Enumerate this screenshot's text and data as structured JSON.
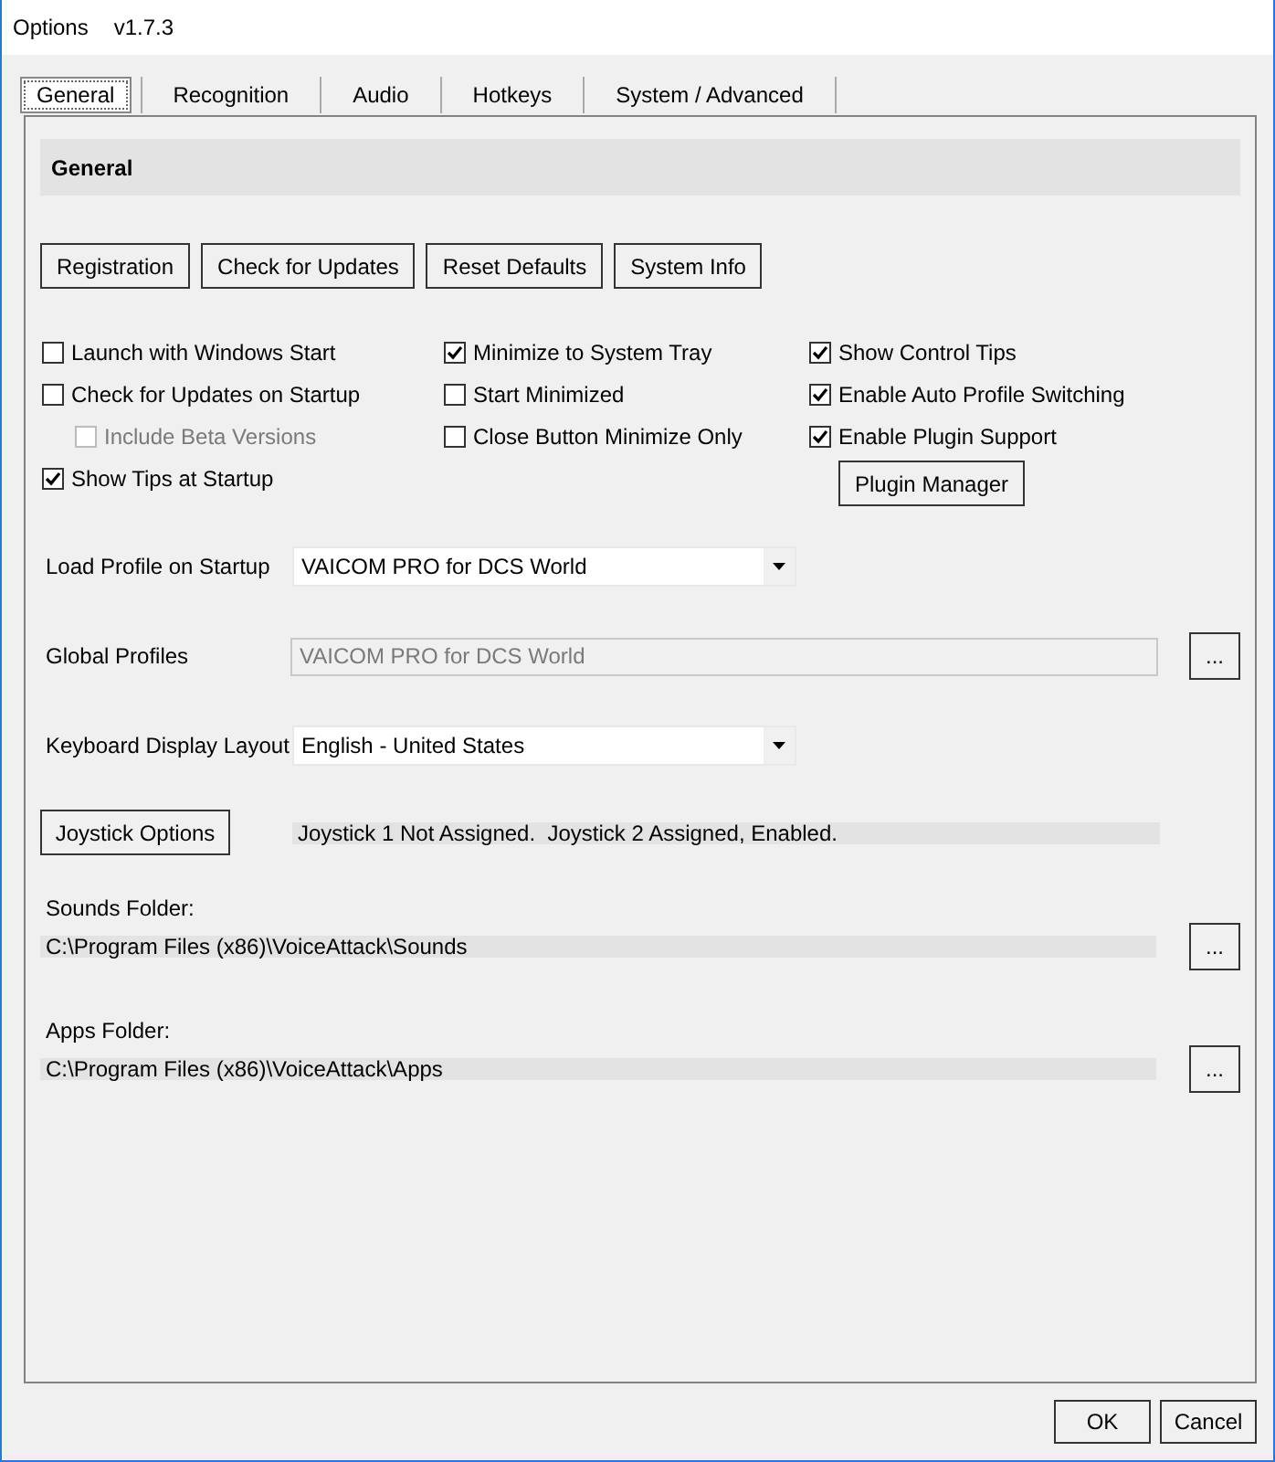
{
  "window": {
    "title": "Options",
    "version": "v1.7.3"
  },
  "tabs": [
    {
      "label": "General",
      "selected": true
    },
    {
      "label": "Recognition",
      "selected": false
    },
    {
      "label": "Audio",
      "selected": false
    },
    {
      "label": "Hotkeys",
      "selected": false
    },
    {
      "label": "System / Advanced",
      "selected": false
    }
  ],
  "section_title": "General",
  "top_buttons": [
    "Registration",
    "Check for Updates",
    "Reset Defaults",
    "System Info"
  ],
  "checkbox_columns": [
    {
      "items": [
        {
          "label": "Launch with Windows Start",
          "checked": false,
          "disabled": false
        },
        {
          "label": "Check for Updates on Startup",
          "checked": false,
          "disabled": false,
          "children": [
            {
              "label": "Include Beta Versions",
              "checked": false,
              "disabled": true
            }
          ]
        },
        {
          "label": "Show Tips at Startup",
          "checked": true,
          "disabled": false
        }
      ]
    },
    {
      "items": [
        {
          "label": "Minimize to System Tray",
          "checked": true,
          "disabled": false
        },
        {
          "label": "Start Minimized",
          "checked": false,
          "disabled": false
        },
        {
          "label": "Close Button Minimize Only",
          "checked": false,
          "disabled": false
        }
      ]
    },
    {
      "items": [
        {
          "label": "Show Control Tips",
          "checked": true,
          "disabled": false
        },
        {
          "label": "Enable Auto Profile Switching",
          "checked": true,
          "disabled": false
        },
        {
          "label": "Enable Plugin Support",
          "checked": true,
          "disabled": false
        }
      ],
      "button": "Plugin Manager"
    }
  ],
  "settings": [
    {
      "kind": "dropdown",
      "label": "Load Profile on Startup",
      "value": "VAICOM PRO for DCS World"
    },
    {
      "kind": "picker",
      "label": "Global Profiles",
      "value": "VAICOM PRO for DCS World",
      "disabled": true,
      "button": "..."
    },
    {
      "kind": "dropdown",
      "label": "Keyboard Display Layout",
      "value": "English - United States"
    }
  ],
  "joystick": {
    "button": "Joystick Options",
    "status": "Joystick 1 Not Assigned.  Joystick 2 Assigned, Enabled."
  },
  "folders": [
    {
      "label": "Sounds Folder:",
      "path": "C:\\Program Files (x86)\\VoiceAttack\\Sounds",
      "button": "..."
    },
    {
      "label": "Apps Folder:",
      "path": "C:\\Program Files (x86)\\VoiceAttack\\Apps",
      "button": "..."
    }
  ],
  "footer_buttons": [
    "OK",
    "Cancel"
  ]
}
